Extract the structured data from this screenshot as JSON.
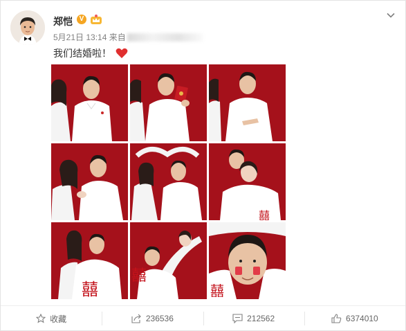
{
  "post": {
    "username": "郑恺",
    "verified_badge": "V",
    "date": "5月21日 13:14",
    "source_prefix": "来自",
    "text": "我们结婚啦！",
    "accent_color": "#a5111b"
  },
  "actions": {
    "favorite_label": "收藏",
    "share_count": "236536",
    "comment_count": "212562",
    "like_count": "6374010"
  }
}
